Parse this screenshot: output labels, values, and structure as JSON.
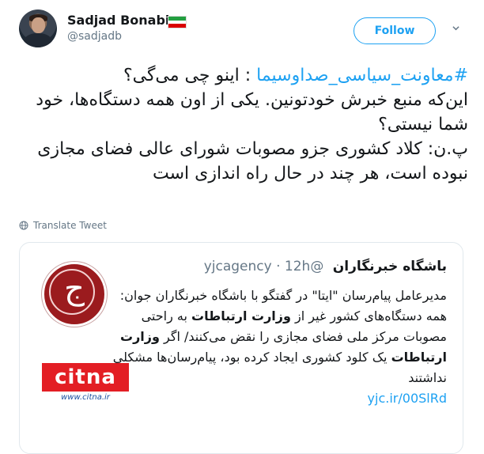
{
  "author": {
    "name": "Sadjad Bonabi",
    "handle": "@sadjadb",
    "flag": [
      "#239f40",
      "#ffffff",
      "#da0000"
    ]
  },
  "follow_label": "Follow",
  "tweet": {
    "hashtag": "#معاونت_سیاسی_صداوسیما",
    "line1_rest": " : اینو چی می‌گی؟",
    "line2": "این‌که منبع خبرش خودتونین. یکی از اون همه دستگاه‌ها، خود شما نیستی؟",
    "line3": "پ.ن: کلاد کشوری جزو مصوبات شورای عالی فضای مجازی نبوده است، هر چند در حال راه اندازی است"
  },
  "translate_label": "Translate Tweet",
  "quote": {
    "name": "باشگاه خبرنگاران",
    "handle": "@yjcagency",
    "time": "· 12h",
    "text_a": "مدیرعامل پیام‌رسان \"ایتا\" در گفتگو با باشگاه خبرنگاران جوان: همه دستگاه‌های کشور غیر از ",
    "bold_a": "وزارت ارتباطات",
    "text_b": " به راحتی مصوبات مرکز ملی فضای مجازی را نقض می‌کنند/ اگر ",
    "bold_b": "وزارت ارتباطات",
    "text_c": " یک کلود کشوری ایجاد کرده بود، پیام‌رسان‌ها مشکلی نداشتند",
    "link": "yjc.ir/00SlRd",
    "logo_mark": "ج"
  },
  "citna": {
    "brand": "citna",
    "url": "www.citna.ir"
  },
  "colors": {
    "accent": "#1da1f2",
    "muted": "#657786",
    "yjc_red": "#9b1b1e",
    "citna_red": "#e31e24"
  }
}
